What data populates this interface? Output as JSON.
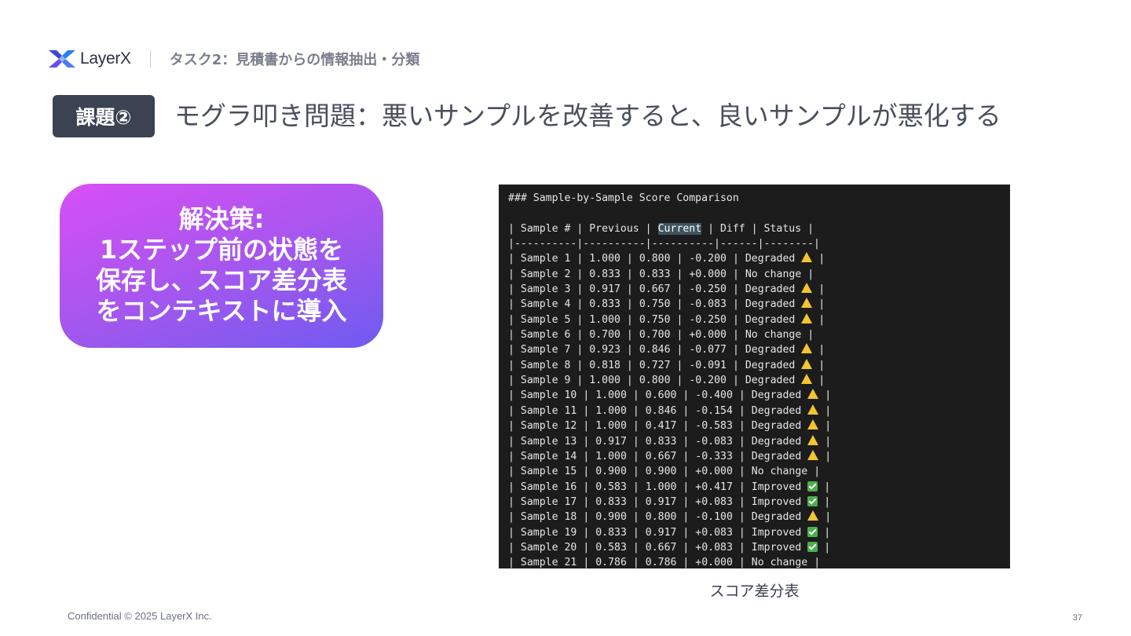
{
  "header": {
    "logo_text": "LayerX",
    "section_title": "タスク2：見積書からの情報抽出・分類"
  },
  "slide": {
    "badge": "課題②",
    "headline": "モグラ叩き問題：悪いサンプルを改善すると、良いサンプルが悪化する"
  },
  "solution": {
    "lines": [
      "解決策:",
      "1ステップ前の状態を",
      "保存し、スコア差分表",
      "をコンテキストに導入"
    ]
  },
  "terminal": {
    "heading": "### Sample-by-Sample Score Comparison",
    "header_row": {
      "pre": "| Sample # | Previous | ",
      "highlight": "Current",
      "post": " | Diff | Status |"
    },
    "separator": "|----------|----------|----------|------|--------|",
    "rows": [
      {
        "sample": "Sample 1",
        "previous": "1.000",
        "current": "0.800",
        "diff": "-0.200",
        "status": "Degraded",
        "icon": "warning"
      },
      {
        "sample": "Sample 2",
        "previous": "0.833",
        "current": "0.833",
        "diff": "+0.000",
        "status": "No change",
        "icon": ""
      },
      {
        "sample": "Sample 3",
        "previous": "0.917",
        "current": "0.667",
        "diff": "-0.250",
        "status": "Degraded",
        "icon": "warning"
      },
      {
        "sample": "Sample 4",
        "previous": "0.833",
        "current": "0.750",
        "diff": "-0.083",
        "status": "Degraded",
        "icon": "warning"
      },
      {
        "sample": "Sample 5",
        "previous": "1.000",
        "current": "0.750",
        "diff": "-0.250",
        "status": "Degraded",
        "icon": "warning"
      },
      {
        "sample": "Sample 6",
        "previous": "0.700",
        "current": "0.700",
        "diff": "+0.000",
        "status": "No change",
        "icon": ""
      },
      {
        "sample": "Sample 7",
        "previous": "0.923",
        "current": "0.846",
        "diff": "-0.077",
        "status": "Degraded",
        "icon": "warning"
      },
      {
        "sample": "Sample 8",
        "previous": "0.818",
        "current": "0.727",
        "diff": "-0.091",
        "status": "Degraded",
        "icon": "warning"
      },
      {
        "sample": "Sample 9",
        "previous": "1.000",
        "current": "0.800",
        "diff": "-0.200",
        "status": "Degraded",
        "icon": "warning"
      },
      {
        "sample": "Sample 10",
        "previous": "1.000",
        "current": "0.600",
        "diff": "-0.400",
        "status": "Degraded",
        "icon": "warning"
      },
      {
        "sample": "Sample 11",
        "previous": "1.000",
        "current": "0.846",
        "diff": "-0.154",
        "status": "Degraded",
        "icon": "warning"
      },
      {
        "sample": "Sample 12",
        "previous": "1.000",
        "current": "0.417",
        "diff": "-0.583",
        "status": "Degraded",
        "icon": "warning"
      },
      {
        "sample": "Sample 13",
        "previous": "0.917",
        "current": "0.833",
        "diff": "-0.083",
        "status": "Degraded",
        "icon": "warning"
      },
      {
        "sample": "Sample 14",
        "previous": "1.000",
        "current": "0.667",
        "diff": "-0.333",
        "status": "Degraded",
        "icon": "warning"
      },
      {
        "sample": "Sample 15",
        "previous": "0.900",
        "current": "0.900",
        "diff": "+0.000",
        "status": "No change",
        "icon": ""
      },
      {
        "sample": "Sample 16",
        "previous": "0.583",
        "current": "1.000",
        "diff": "+0.417",
        "status": "Improved",
        "icon": "check"
      },
      {
        "sample": "Sample 17",
        "previous": "0.833",
        "current": "0.917",
        "diff": "+0.083",
        "status": "Improved",
        "icon": "check"
      },
      {
        "sample": "Sample 18",
        "previous": "0.900",
        "current": "0.800",
        "diff": "-0.100",
        "status": "Degraded",
        "icon": "warning"
      },
      {
        "sample": "Sample 19",
        "previous": "0.833",
        "current": "0.917",
        "diff": "+0.083",
        "status": "Improved",
        "icon": "check"
      },
      {
        "sample": "Sample 20",
        "previous": "0.583",
        "current": "0.667",
        "diff": "+0.083",
        "status": "Improved",
        "icon": "check"
      },
      {
        "sample": "Sample 21",
        "previous": "0.786",
        "current": "0.786",
        "diff": "+0.000",
        "status": "No change",
        "icon": ""
      }
    ]
  },
  "caption": "スコア差分表",
  "footer": {
    "confidential": "Confidential © 2025 LayerX Inc.",
    "page_number": "37"
  },
  "colors": {
    "badge_bg": "#3b4352",
    "gradient_start": "#d84ff5",
    "gradient_end": "#6f5bf0",
    "terminal_bg": "#1c1c1c",
    "warning": "#f2c531",
    "check": "#4cae4f"
  }
}
